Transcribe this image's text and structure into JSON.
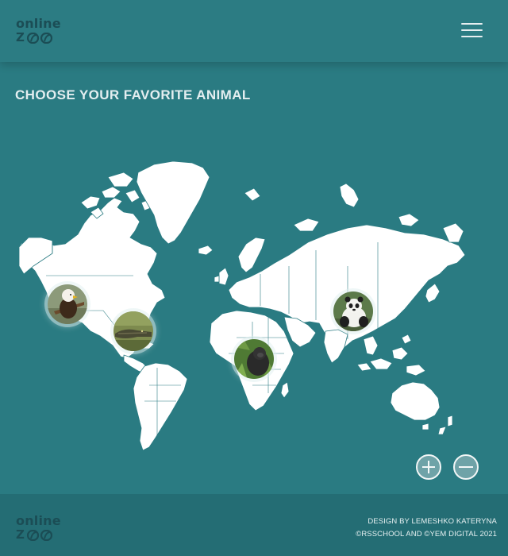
{
  "header": {
    "logo_word": "online",
    "logo_z": "Z"
  },
  "page": {
    "title": "CHOOSE YOUR FAVORITE ANIMAL"
  },
  "map": {
    "land_color": "#ffffff",
    "water_color": "#2a7b82",
    "animals": [
      "eagle",
      "alligator",
      "gorilla",
      "panda"
    ]
  },
  "footer": {
    "logo_word": "online",
    "logo_z": "Z",
    "design_credit": "DESIGN BY LEMESHKO KATERYNA",
    "copyright": "©RSSCHOOL AND ©YEM DIGITAL 2021"
  },
  "colors": {
    "background": "#2a7b82",
    "header": "#2c7c83",
    "footer": "#246d74",
    "logo": "#1b4d55"
  }
}
